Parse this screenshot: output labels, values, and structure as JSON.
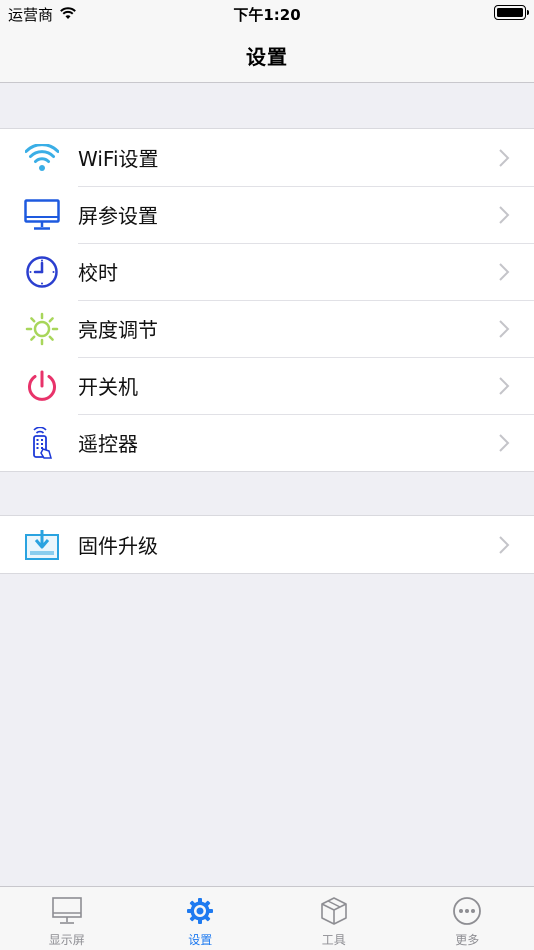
{
  "status_bar": {
    "carrier": "运营商",
    "time": "下午1:20"
  },
  "nav": {
    "title": "设置"
  },
  "groups": [
    {
      "items": [
        {
          "label": "WiFi设置",
          "icon": "wifi-icon",
          "color": "#3aaee6"
        },
        {
          "label": "屏参设置",
          "icon": "monitor-icon",
          "color": "#1e5adf"
        },
        {
          "label": "校时",
          "icon": "clock-icon",
          "color": "#2b3fcf"
        },
        {
          "label": "亮度调节",
          "icon": "sun-icon",
          "color": "#a8d65a"
        },
        {
          "label": "开关机",
          "icon": "power-icon",
          "color": "#e8336a"
        },
        {
          "label": "遥控器",
          "icon": "remote-icon",
          "color": "#1e3ad8"
        }
      ]
    },
    {
      "items": [
        {
          "label": "固件升级",
          "icon": "firmware-download-icon",
          "color": "#2aa3e0"
        }
      ]
    }
  ],
  "tab_bar": {
    "tabs": [
      {
        "label": "显示屏",
        "icon": "display-icon",
        "active": false
      },
      {
        "label": "设置",
        "icon": "gear-icon",
        "active": true
      },
      {
        "label": "工具",
        "icon": "box-icon",
        "active": false
      },
      {
        "label": "更多",
        "icon": "more-icon",
        "active": false
      }
    ],
    "active_color": "#1e7af0",
    "inactive_color": "#8e8e93"
  }
}
